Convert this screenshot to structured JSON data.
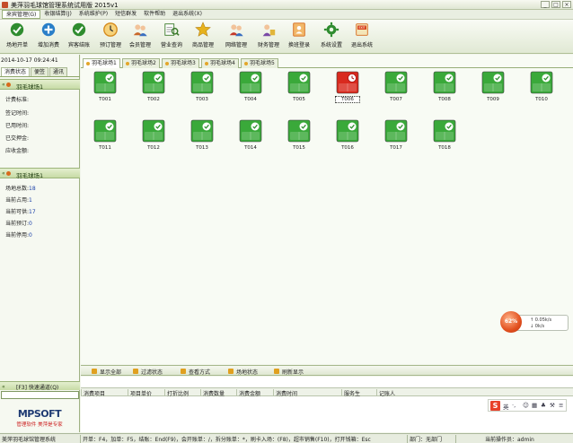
{
  "window": {
    "title": "美萍羽毛球馆管理系统试用版 2015v1",
    "minimize": "_",
    "maximize": "□",
    "close": "×"
  },
  "menu": [
    "来宾管理(G)",
    "收银结算(J)",
    "系统维护(P)",
    "短信群发",
    "软件帮助",
    "退出系统(X)"
  ],
  "toolbar": [
    {
      "label": "场地开单",
      "icon": "venue-open-icon",
      "color": "#2f8c2f"
    },
    {
      "label": "增加消费",
      "icon": "add-consumption-icon",
      "color": "#2a7ec8"
    },
    {
      "label": "宾客结账",
      "icon": "checkout-icon",
      "color": "#2f8c2f"
    },
    {
      "label": "预订管理",
      "icon": "clock-icon",
      "color": "#d58a1c"
    },
    {
      "label": "会员管理",
      "icon": "member-icon",
      "color": "#c9672a"
    },
    {
      "label": "营业查询",
      "icon": "query-icon",
      "color": "#3a7a2a"
    },
    {
      "label": "商品管理",
      "icon": "star-icon",
      "color": "#e6b21e"
    },
    {
      "label": "网络管理",
      "icon": "network-icon",
      "color": "#c43a2a"
    },
    {
      "label": "财务管理",
      "icon": "finance-icon",
      "color": "#7a4aa6"
    },
    {
      "label": "换班登录",
      "icon": "shift-icon",
      "color": "#d66a1c"
    },
    {
      "label": "系统设置",
      "icon": "settings-icon",
      "color": "#2f8c2f"
    },
    {
      "label": "退出系统",
      "icon": "exit-icon",
      "color": "#d66a1c"
    }
  ],
  "left": {
    "datetime": "2014-10-17 09:24:41",
    "tabs": [
      "消费状态",
      "便签",
      "通讯"
    ],
    "section1_title": "羽毛球场1",
    "section1_fields": [
      "计费标准:",
      "签记时间:",
      "已用时间:",
      "已交押金:",
      "应收金额:"
    ],
    "section2_title": "羽毛球场1",
    "section2_fields": [
      {
        "label": "场地总数:",
        "value": "18"
      },
      {
        "label": "当前占用:",
        "value": "1"
      },
      {
        "label": "当前可供:",
        "value": "17"
      },
      {
        "label": "当前预订:",
        "value": "0"
      },
      {
        "label": "当前停用:",
        "value": "0"
      }
    ],
    "quick_title": "[F3] 快速通道(Q)",
    "logo_main": "MPSOFT",
    "logo_sub": "管理软件 美萍是专家"
  },
  "center": {
    "tabs": [
      "羽毛球场1",
      "羽毛球场2",
      "羽毛球场3",
      "羽毛球场4",
      "羽毛球场5"
    ],
    "courts": [
      {
        "label": "T001",
        "status": "free"
      },
      {
        "label": "T002",
        "status": "free"
      },
      {
        "label": "T003",
        "status": "free"
      },
      {
        "label": "T004",
        "status": "free"
      },
      {
        "label": "T005",
        "status": "free"
      },
      {
        "label": "T006",
        "status": "occupied"
      },
      {
        "label": "T007",
        "status": "free"
      },
      {
        "label": "T008",
        "status": "free"
      },
      {
        "label": "T009",
        "status": "free"
      },
      {
        "label": "T010",
        "status": "free"
      },
      {
        "label": "T011",
        "status": "free"
      },
      {
        "label": "T012",
        "status": "free"
      },
      {
        "label": "T013",
        "status": "free"
      },
      {
        "label": "T014",
        "status": "free"
      },
      {
        "label": "T015",
        "status": "free"
      },
      {
        "label": "T016",
        "status": "free"
      },
      {
        "label": "T017",
        "status": "free"
      },
      {
        "label": "T018",
        "status": "free"
      }
    ],
    "colors": {
      "free": "#3aa93a",
      "occupied": "#d92a1e"
    }
  },
  "widget": {
    "percent": "62%",
    "up": "0.05k/s",
    "down": "0k/s"
  },
  "filters": [
    "显示全部",
    "过滤状态",
    "查看方式",
    "场地状态",
    "刷新显示"
  ],
  "table_headers": [
    "消费项目",
    "项目单价",
    "打折比例",
    "消费数量",
    "消费金额",
    "消费时间",
    "服务生",
    "记账人"
  ],
  "ime": {
    "logo": "S",
    "label": "英"
  },
  "status_bar": [
    "美萍羽毛球馆管理系统",
    "开单：F4，加单：F5，结账：End(F9)，会开账单：/，拆分账单：*，刷卡入场：(F8)，超市销售(F10)，打开钱箱：Esc",
    "部门：无部门",
    "当前操作员：admin"
  ]
}
